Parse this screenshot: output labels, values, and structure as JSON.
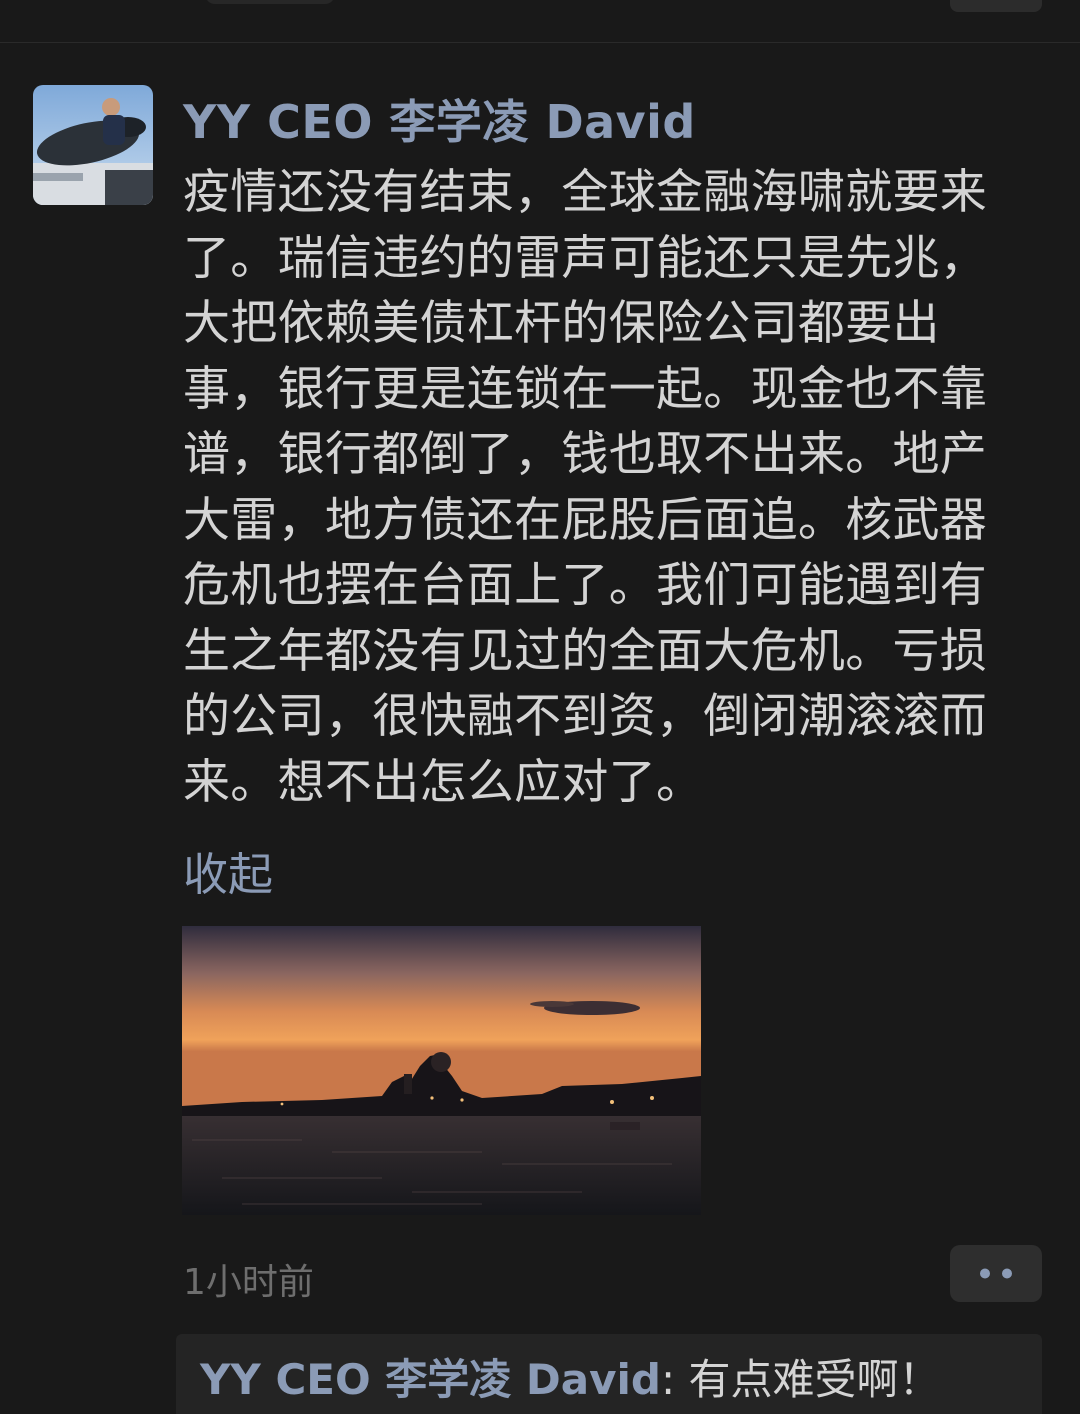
{
  "post": {
    "author": "YY CEO 李学凌 David",
    "text": "疫情还没有结束，全球金融海啸就要来\n了。瑞信违约的雷声可能还只是先兆，\n大把依赖美债杠杆的保险公司都要出\n事，银行更是连锁在一起。现金也不靠\n谱，银行都倒了，钱也取不出来。地产\n大雷，地方债还在屁股后面追。核武器\n危机也摆在台面上了。我们可能遇到有\n生之年都没有见过的全面大危机。亏损\n的公司，很快融不到资，倒闭潮滚滚而\n来。想不出怎么应对了。",
    "collapse_label": "收起",
    "timestamp": "1小时前",
    "more_icon": "more-dots-icon"
  },
  "comments": [
    {
      "author": "YY CEO 李学凌 David",
      "separator": ": ",
      "text": "有点难受啊！"
    }
  ],
  "colors": {
    "background": "#191919",
    "link": "#8b9bb6",
    "text": "#d4d4d4",
    "muted": "#6e6e6e"
  }
}
